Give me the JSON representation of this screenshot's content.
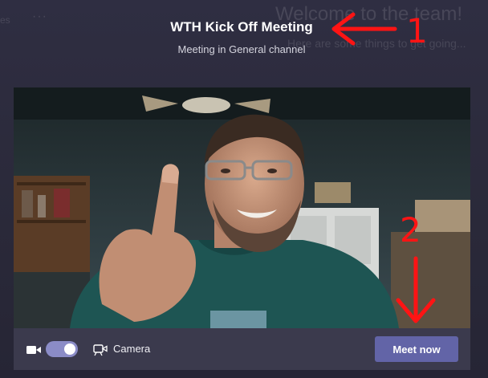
{
  "background": {
    "left_label": "es",
    "more_glyph": "···",
    "welcome_text": "Welcome to the team!",
    "welcome_sub": "Here are some things to get going..."
  },
  "meeting": {
    "title": "WTH Kick Off Meeting",
    "subtitle": "Meeting in General channel"
  },
  "controls": {
    "video_icon": "video-camera-icon",
    "camera_toggle_on": true,
    "camera_label": "Camera",
    "camera_settings_icon": "camera-settings-icon",
    "meet_now_label": "Meet now"
  },
  "annotations": {
    "label_1": "1",
    "label_2": "2",
    "color": "#ff1414"
  },
  "colors": {
    "accent": "#6264a7",
    "toggle_on": "#8b8cc7",
    "background": "#2d2c3d",
    "control_bar": "#3b3a4d"
  }
}
